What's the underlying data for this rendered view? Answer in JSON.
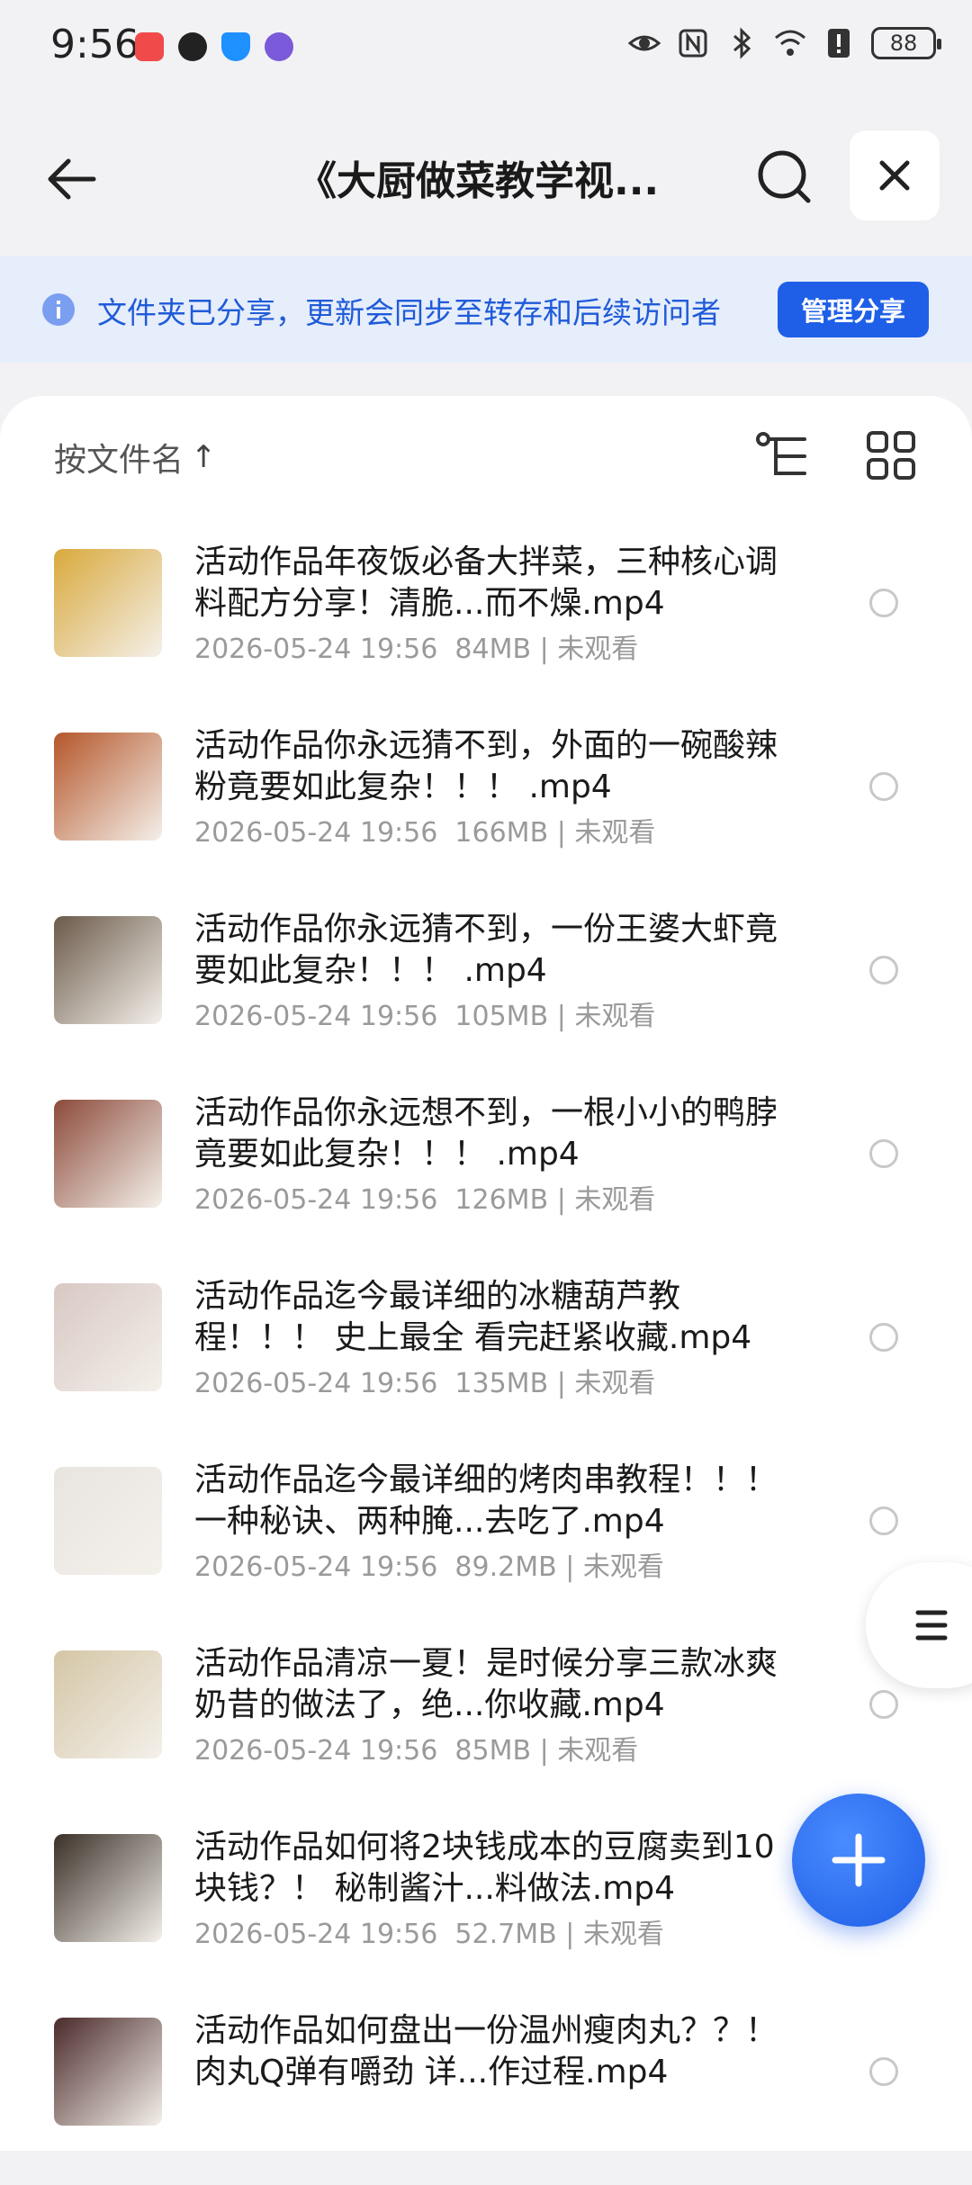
{
  "status": {
    "time": "9:56",
    "battery": "88"
  },
  "header": {
    "title": "《大厨做菜教学视..."
  },
  "banner": {
    "text": "文件夹已分享，更新会同步至转存和后续访问者",
    "manage_label": "管理分享"
  },
  "sort": {
    "label": "按文件名",
    "arrow": "↑"
  },
  "files": [
    {
      "name": "活动作品年夜饭必备大拌菜，三种核心调料配方分享！清脆...而不燥.mp4",
      "date": "2026-05-24 19:56",
      "size": "84MB",
      "status": "未观看",
      "thumb": "#d9a93c"
    },
    {
      "name": "活动作品你永远猜不到，外面的一碗酸辣粉竟要如此复杂！！！ .mp4",
      "date": "2026-05-24 19:56",
      "size": "166MB",
      "status": "未观看",
      "thumb": "#b5562a"
    },
    {
      "name": "活动作品你永远猜不到，一份王婆大虾竟要如此复杂！！！ .mp4",
      "date": "2026-05-24 19:56",
      "size": "105MB",
      "status": "未观看",
      "thumb": "#6b5a4a"
    },
    {
      "name": "活动作品你永远想不到，一根小小的鸭脖竟要如此复杂！！！ .mp4",
      "date": "2026-05-24 19:56",
      "size": "126MB",
      "status": "未观看",
      "thumb": "#8c4a3a"
    },
    {
      "name": "活动作品迄今最详细的冰糖葫芦教程！！！ 史上最全 看完赶紧收藏.mp4",
      "date": "2026-05-24 19:56",
      "size": "135MB",
      "status": "未观看",
      "thumb": "#d8c8c4"
    },
    {
      "name": "活动作品迄今最详细的烤肉串教程！！！ 一种秘诀、两种腌...去吃了.mp4",
      "date": "2026-05-24 19:56",
      "size": "89.2MB",
      "status": "未观看",
      "thumb": "#e8e4e0"
    },
    {
      "name": "活动作品清凉一夏！是时候分享三款冰爽奶昔的做法了，绝...你收藏.mp4",
      "date": "2026-05-24 19:56",
      "size": "85MB",
      "status": "未观看",
      "thumb": "#d4c6a6"
    },
    {
      "name": "活动作品如何将2块钱成本的豆腐卖到10块钱？！ 秘制酱汁...料做法.mp4",
      "date": "2026-05-24 19:56",
      "size": "52.7MB",
      "status": "未观看",
      "thumb": "#3a3028"
    },
    {
      "name": "活动作品如何盘出一份温州瘦肉丸？？！ 肉丸Q弹有嚼劲 详...作过程.mp4",
      "date": "2026-05-24 19:56",
      "size": "",
      "status": "",
      "thumb": "#4a2a2a"
    }
  ]
}
